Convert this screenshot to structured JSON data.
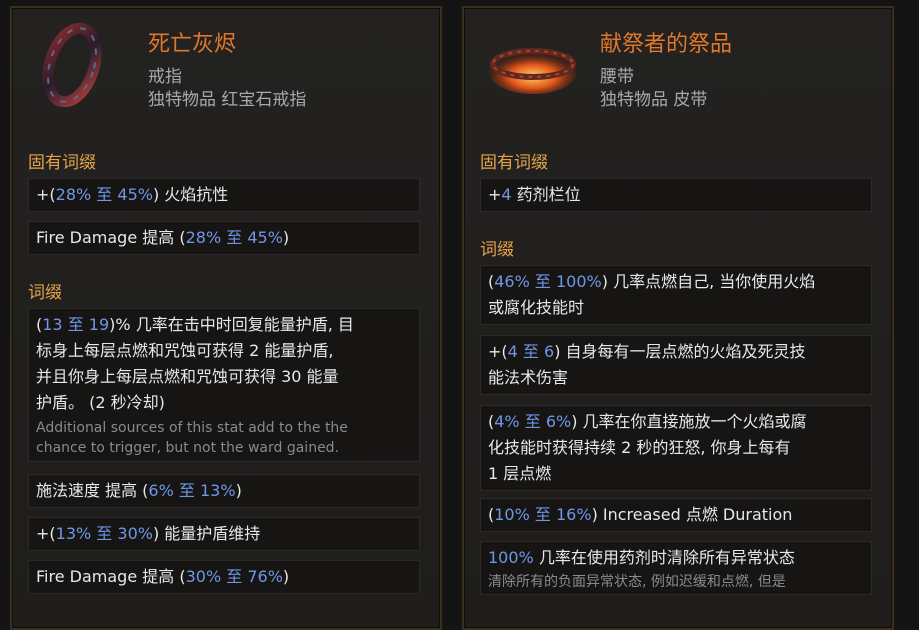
{
  "left": {
    "name": "死亡灰烬",
    "type": "戒指",
    "subtype": "独特物品 红宝石戒指",
    "implicit_title": "固有词缀",
    "implicits": [
      {
        "pre": "+(",
        "a": "28%",
        "mid": " 至 ",
        "b": "45%",
        "post": ") 火焰抗性"
      },
      {
        "pre": "Fire Damage 提高 (",
        "a": "28%",
        "mid": " 至 ",
        "b": "45%",
        "post": ")"
      }
    ],
    "affix_title": "词缀",
    "affix1": {
      "pre": "(",
      "a": "13",
      "mid": " 至 ",
      "b": "19",
      "post": ")% 几率在击中时回复能量护盾, 目",
      "line2": "标身上每层点燃和咒蚀可获得 2 能量护盾,",
      "line3": "并且你身上每层点燃和咒蚀可获得 30 能量",
      "line4": "护盾。  (2 秒冷却)",
      "note1": "Additional sources of this stat add to the the",
      "note2": "chance to trigger, but not the ward gained."
    },
    "affix2": {
      "pre": "施法速度 提高 (",
      "a": "6%",
      "mid": " 至 ",
      "b": "13%",
      "post": ")"
    },
    "affix3": {
      "pre": "+(",
      "a": "13%",
      "mid": " 至 ",
      "b": "30%",
      "post": ") 能量护盾维持"
    },
    "affix4": {
      "pre": "Fire Damage 提高 (",
      "a": "30%",
      "mid": " 至 ",
      "b": "76%",
      "post": ")"
    }
  },
  "right": {
    "name": "献祭者的祭品",
    "type": "腰带",
    "subtype": "独特物品 皮带",
    "implicit_title": "固有词缀",
    "implicit": {
      "pre": "+",
      "a": "4",
      "post": " 药剂栏位"
    },
    "affix_title": "词缀",
    "affix1": {
      "pre": "(",
      "a": "46%",
      "mid": " 至 ",
      "b": "100%",
      "post": ") 几率点燃自己, 当你使用火焰",
      "line2": "或腐化技能时"
    },
    "affix2": {
      "pre": "+(",
      "a": "4",
      "mid": " 至 ",
      "b": "6",
      "post": ") 自身每有一层点燃的火焰及死灵技",
      "line2": "能法术伤害"
    },
    "affix3": {
      "pre": "(",
      "a": "4%",
      "mid": " 至 ",
      "b": "6%",
      "post": ") 几率在你直接施放一个火焰或腐",
      "line2": "化技能时获得持续 2 秒的狂怒, 你身上每有",
      "line3": "1 层点燃"
    },
    "affix4": {
      "pre": "(",
      "a": "10%",
      "mid": " 至 ",
      "b": "16%",
      "post": ") Increased 点燃 Duration"
    },
    "affix5": {
      "a": "100%",
      "post": " 几率在使用药剂时清除所有异常状态",
      "note": "清除所有的负面异常状态, 例如迟缓和点燃, 但是"
    }
  },
  "colors": {
    "accent_name": "#e0782a",
    "section": "#e6a34a",
    "value": "#6f97e6",
    "bg": "#232221"
  }
}
